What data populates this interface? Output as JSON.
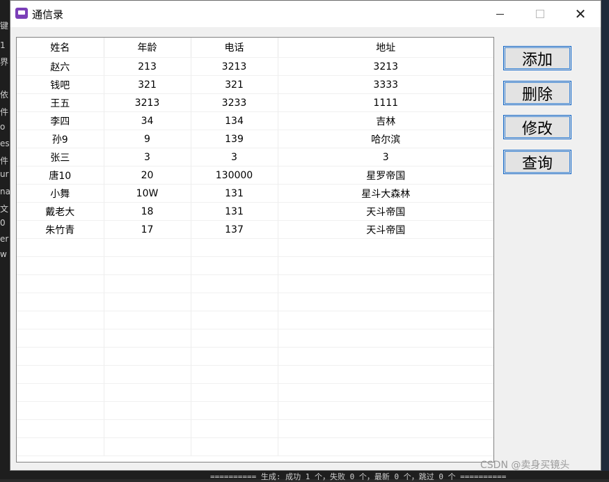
{
  "window": {
    "title": "通信录"
  },
  "table": {
    "headers": [
      "姓名",
      "年龄",
      "电话",
      "地址"
    ],
    "rows": [
      [
        "赵六",
        "213",
        "3213",
        "3213"
      ],
      [
        "钱吧",
        "321",
        "321",
        "3333"
      ],
      [
        "王五",
        "3213",
        "3233",
        "1111"
      ],
      [
        "李四",
        "34",
        "134",
        "吉林"
      ],
      [
        "孙9",
        "9",
        "139",
        "哈尔滨"
      ],
      [
        "张三",
        "3",
        "3",
        "3"
      ],
      [
        "唐10",
        "20",
        "130000",
        "星罗帝国"
      ],
      [
        "小舞",
        "10W",
        "131",
        "星斗大森林"
      ],
      [
        "戴老大",
        "18",
        "131",
        "天斗帝国"
      ],
      [
        "朱竹青",
        "17",
        "137",
        "天斗帝国"
      ]
    ],
    "empty_rows": 12
  },
  "buttons": {
    "add": "添加",
    "delete": "删除",
    "modify": "修改",
    "query": "查询"
  },
  "background": {
    "bottom_text": "========== 生成: 成功 1 个，失败 0 个，最新 0 个，跳过 0 个 ==========",
    "watermark": "CSDN @卖身买镜头",
    "left_chars": [
      "键",
      "1",
      "界",
      "依",
      "件",
      "o",
      "es",
      "件",
      "ur",
      "na",
      "文",
      "0",
      "er",
      "w"
    ]
  }
}
